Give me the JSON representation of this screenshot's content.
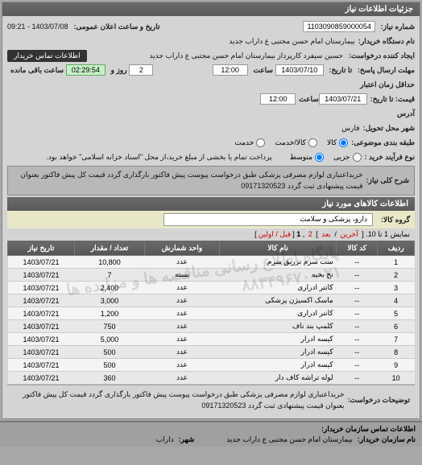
{
  "header": {
    "title": "جزئیات اطلاعات نیاز"
  },
  "info": {
    "labels": {
      "req_no": "شماره نیاز:",
      "pub_date": "تاریخ و ساعت اعلان عمومی:",
      "org": "نام دستگاه خریدار:",
      "creator": "ایجاد کننده درخواست:",
      "contact": "اطلاعات تماس خریدار",
      "send_deadline": "مهلت ارسال پاسخ:",
      "to_date": "تا تاریخ:",
      "price_validity": "حداقل زمان اعتبار",
      "price_validity2": "قیمت: تا تاریخ:",
      "time_lbl": "ساعت",
      "days_lbl": "روز و",
      "remain_lbl": "ساعت باقی مانده",
      "address": "آدرس"
    },
    "req_no": "1103090859000054",
    "pub_date": "1403/07/08 - 09:21",
    "org": "بیمارستان امام حسن مجتبی  ع  داراب جدید",
    "creator": "حسین سیفرد کارپرداز بیمارستان امام حسن مجتبی  ع  داراب جدید",
    "send_date": "1403/07/10",
    "send_time": "12:00",
    "countdown_days": "2",
    "countdown_time": "02:29:54",
    "validity_date": "1403/07/21",
    "validity_time": "12:00",
    "city_lbl": "شهر محل تحویل:",
    "city": "فارس",
    "pkg_lbl": "طبقه بندی موضوعی:",
    "radios": {
      "r1": "کالا",
      "r2": "کالا/خدمت",
      "r3": "خدمت"
    },
    "process_lbl": "نوع فرآیند خرید :",
    "process_radios": {
      "r1": "جزیی",
      "r2": "متوسط"
    },
    "process_note": "پرداخت تمام یا بخشی از مبلغ خرید،از محل \"اسناد خزانه اسلامی\" خواهد بود."
  },
  "desc": {
    "label": "شرح کلی نیاز:",
    "text": "خریداعتباری لوازم مصرفی پزشکی طبق درخواست پیوست پیش فاکتور بارگذاری گردد قیمت کل پیش فاکتور بعنوان قیمت پیشنهادی ثبت گردد 09171320523"
  },
  "items": {
    "header": "اطلاعات کالاهای مورد نیاز",
    "group_lbl": "گروه کالا:",
    "group_val": "دارو، پزشکی و سلامت",
    "pager": {
      "text1": "نمایش 1 تا 10.",
      "last": "آخرین",
      "next": "بعد",
      "p2": "2",
      "p1": "1",
      "first": "قبل / اولین"
    },
    "cols": {
      "row": "ردیف",
      "code": "کد کالا",
      "name": "نام کالا",
      "unit": "واحد شمارش",
      "qty": "تعداد / مقدار",
      "date": "تاریخ نیاز"
    },
    "rows": [
      {
        "n": "1",
        "code": "--",
        "name": "ست سرم تزریق سرم",
        "unit": "عدد",
        "qty": "10,800",
        "date": "1403/07/21"
      },
      {
        "n": "2",
        "code": "--",
        "name": "نخ بخیه",
        "unit": "بسته",
        "qty": "7",
        "date": "1403/07/21"
      },
      {
        "n": "3",
        "code": "--",
        "name": "کانتر ادراری",
        "unit": "عدد",
        "qty": "2,400",
        "date": "1403/07/21"
      },
      {
        "n": "4",
        "code": "--",
        "name": "ماسک اکسیژن پزشکی",
        "unit": "عدد",
        "qty": "3,000",
        "date": "1403/07/21"
      },
      {
        "n": "5",
        "code": "--",
        "name": "کانتر ادراری",
        "unit": "عدد",
        "qty": "1,200",
        "date": "1403/07/21"
      },
      {
        "n": "6",
        "code": "--",
        "name": "کلمپ بند ناف",
        "unit": "عدد",
        "qty": "750",
        "date": "1403/07/21"
      },
      {
        "n": "7",
        "code": "--",
        "name": "کیسه ادرار",
        "unit": "عدد",
        "qty": "5,000",
        "date": "1403/07/21"
      },
      {
        "n": "8",
        "code": "--",
        "name": "کیسه ادرار",
        "unit": "عدد",
        "qty": "500",
        "date": "1403/07/21"
      },
      {
        "n": "9",
        "code": "--",
        "name": "کیسه ادرار",
        "unit": "عدد",
        "qty": "500",
        "date": "1403/07/21"
      },
      {
        "n": "10",
        "code": "--",
        "name": "لوله تراشه کاف دار",
        "unit": "عدد",
        "qty": "360",
        "date": "1403/07/21"
      }
    ]
  },
  "desc2": {
    "label": "توضیحات درخواست:",
    "text": "خریداعتباری لوازم مصرفی پزشکی طبق درخواست پیوست پیش فاکتور بارگذاری گردد قیمت کل پیش فاکتور بعنوان قیمت پیشنهادی ثبت گردد 09171320523"
  },
  "bottom": {
    "contact_header": "اطلاعات تماس سازمان خریدار:",
    "org_lbl": "نام سازمان خریدار:",
    "org_val": "بیمارستان امام حسن مجتبی ع داراب جدید",
    "city_lbl": "شهر:",
    "city_val": "داراب"
  },
  "watermark": "پایگاه اطلاع رسانی مناقصه ها و مزایده ها\n۰۲۱-۸۸۳۴۹۶۷۰"
}
